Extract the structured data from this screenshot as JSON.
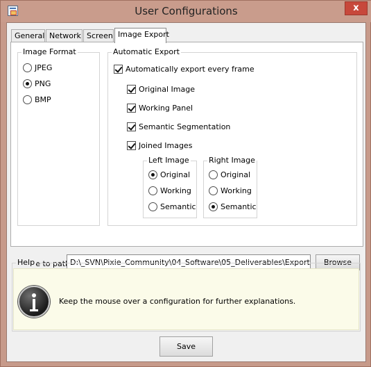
{
  "window": {
    "title": "User Configurations",
    "close_glyph": "x",
    "app_icon": "window-app-icon"
  },
  "tabs": [
    {
      "label": "General"
    },
    {
      "label": "Network"
    },
    {
      "label": "Screen"
    },
    {
      "label": "Image Export",
      "active": true
    }
  ],
  "image_format": {
    "title": "Image Format",
    "options": [
      {
        "label": "JPEG",
        "selected": false
      },
      {
        "label": "PNG",
        "selected": true
      },
      {
        "label": "BMP",
        "selected": false
      }
    ]
  },
  "auto_export": {
    "title": "Automatic Export",
    "every_frame": {
      "label": "Automatically export every frame",
      "checked": true
    },
    "items": [
      {
        "label": "Original Image",
        "checked": true
      },
      {
        "label": "Working Panel",
        "checked": true
      },
      {
        "label": "Semantic Segmentation",
        "checked": true
      },
      {
        "label": "Joined Images",
        "checked": true
      }
    ],
    "left_image": {
      "title": "Left Image",
      "options": [
        {
          "label": "Original",
          "selected": true
        },
        {
          "label": "Working",
          "selected": false
        },
        {
          "label": "Semantic",
          "selected": false
        }
      ]
    },
    "right_image": {
      "title": "Right Image",
      "options": [
        {
          "label": "Original",
          "selected": false
        },
        {
          "label": "Working",
          "selected": false
        },
        {
          "label": "Semantic",
          "selected": true
        }
      ]
    }
  },
  "save_path": {
    "label": "Save to path",
    "value": "D:\\_SVN\\Pixie_Community\\04_Software\\05_Deliverables\\Export",
    "browse_label": "Browse"
  },
  "help": {
    "title": "Help",
    "text": "Keep the mouse over a configuration for further explanations.",
    "icon": "info-icon"
  },
  "footer": {
    "save_label": "Save"
  },
  "colors": {
    "titlebar": "#c99c8c",
    "close_button": "#c7483b",
    "help_background": "#fbfbe9",
    "dialog_background": "#f0f0f0"
  }
}
